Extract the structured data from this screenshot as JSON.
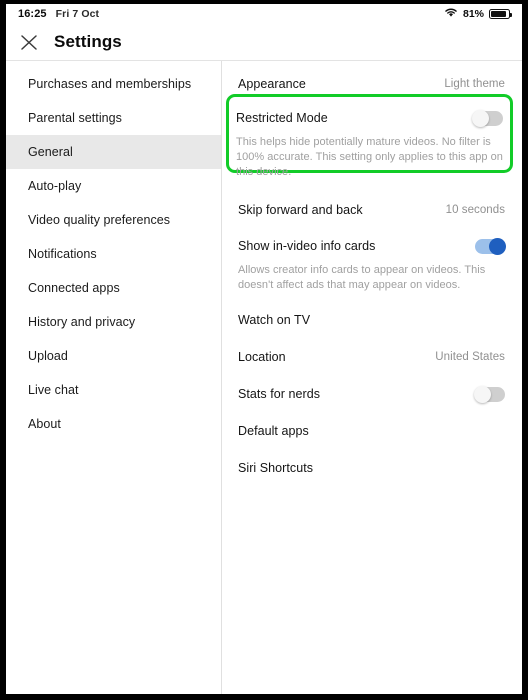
{
  "statusbar": {
    "time": "16:25",
    "date": "Fri 7 Oct",
    "wifi_icon": "wifi-icon",
    "battery_percent": "81%",
    "battery_level": 81,
    "battery_icon": "battery-icon"
  },
  "header": {
    "close_icon": "close-icon",
    "title": "Settings"
  },
  "sidebar": {
    "items": [
      {
        "label": "Purchases and memberships",
        "selected": false
      },
      {
        "label": "Parental settings",
        "selected": false
      },
      {
        "label": "General",
        "selected": true
      },
      {
        "label": "Auto-play",
        "selected": false
      },
      {
        "label": "Video quality preferences",
        "selected": false
      },
      {
        "label": "Notifications",
        "selected": false
      },
      {
        "label": "Connected apps",
        "selected": false
      },
      {
        "label": "History and privacy",
        "selected": false
      },
      {
        "label": "Upload",
        "selected": false
      },
      {
        "label": "Live chat",
        "selected": false
      },
      {
        "label": "About",
        "selected": false
      }
    ]
  },
  "main": {
    "appearance": {
      "label": "Appearance",
      "value": "Light theme"
    },
    "restricted_mode": {
      "label": "Restricted Mode",
      "description": "This helps hide potentially mature videos. No filter is 100% accurate. This setting only applies to this app on this device.",
      "toggle_state": "off",
      "highlighted": true,
      "highlight_color": "#12cc28"
    },
    "skip_forward_back": {
      "label": "Skip forward and back",
      "value": "10 seconds"
    },
    "info_cards": {
      "label": "Show in-video info cards",
      "description": "Allows creator info cards to appear on videos. This doesn't affect ads that may appear on videos.",
      "toggle_state": "on"
    },
    "watch_on_tv": {
      "label": "Watch on TV"
    },
    "location": {
      "label": "Location",
      "value": "United States"
    },
    "stats_for_nerds": {
      "label": "Stats for nerds",
      "toggle_state": "off"
    },
    "default_apps": {
      "label": "Default apps"
    },
    "siri_shortcuts": {
      "label": "Siri Shortcuts"
    }
  }
}
